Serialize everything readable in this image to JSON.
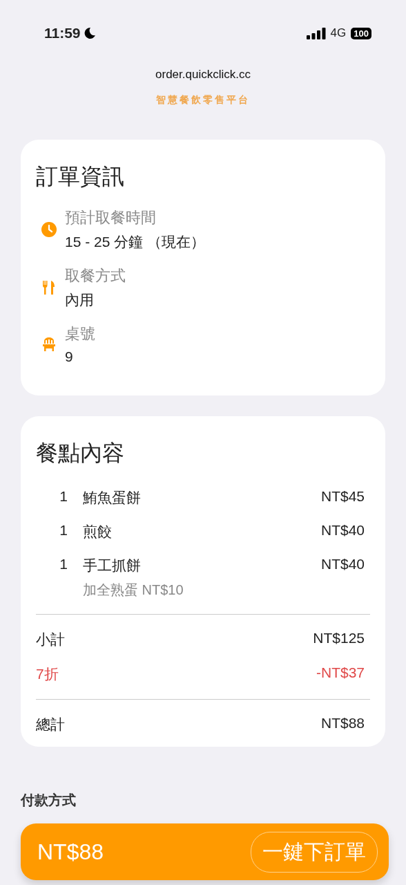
{
  "status_bar": {
    "time": "11:59",
    "network": "4G",
    "battery": "100"
  },
  "header": {
    "tagline": "智慧餐飲零售平台",
    "url": "order.quickclick.cc"
  },
  "order_info": {
    "title": "訂單資訊",
    "rows": [
      {
        "kind": "time",
        "label": "預計取餐時間",
        "value": "15 - 25 分鐘 （現在）"
      },
      {
        "kind": "dining",
        "label": "取餐方式",
        "value": "內用"
      },
      {
        "kind": "table",
        "label": "桌號",
        "value": "9"
      }
    ]
  },
  "order_items": {
    "title": "餐點內容",
    "items": [
      {
        "qty": "1",
        "name": "鮪魚蛋餅",
        "price": "NT$45"
      },
      {
        "qty": "1",
        "name": "煎餃",
        "price": "NT$40"
      },
      {
        "qty": "1",
        "name": "手工抓餅",
        "price": "NT$40",
        "options": "加全熟蛋 NT$10"
      }
    ],
    "summary": [
      {
        "kind": "subtotal",
        "label": "小計",
        "amount": "NT$125"
      },
      {
        "kind": "discount",
        "label": "7折",
        "amount": "-NT$37"
      }
    ],
    "total": {
      "label": "總計",
      "amount": "NT$88"
    }
  },
  "payment": {
    "title": "付款方式"
  },
  "checkout": {
    "total": "NT$88",
    "button": "一鍵下訂單"
  }
}
